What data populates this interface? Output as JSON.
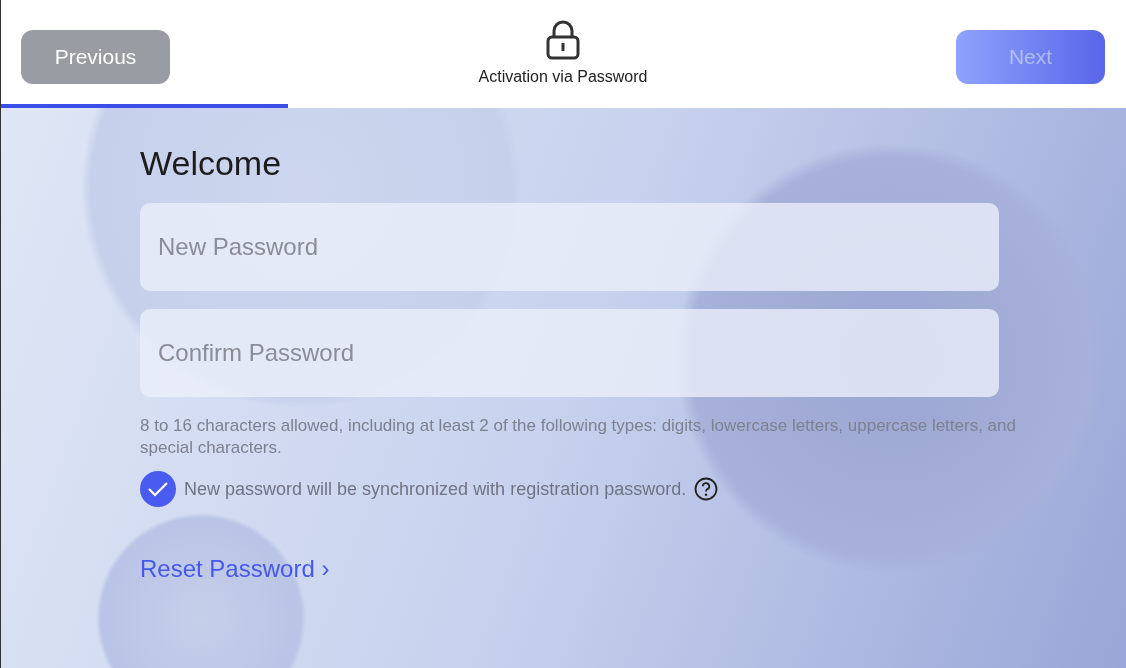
{
  "header": {
    "previous": {
      "label": "Previous"
    },
    "title": "Activation via Password",
    "next": {
      "label": "Next",
      "disabled": true
    },
    "progress": {
      "level": 0.255
    }
  },
  "form": {
    "heading": "Welcome",
    "fields": [
      {
        "placeholder": "New Password"
      },
      {
        "placeholder": "Confirm Password"
      }
    ],
    "hint": "8 to 16 characters allowed, including at least 2 of the following types: digits, lowercase letters, uppercase letters, and special characters.",
    "sync": {
      "label": "New password will be synchronized with registration password.",
      "checked": true
    },
    "reset_link": {
      "label": "Reset Password",
      "chevron": "›"
    }
  }
}
